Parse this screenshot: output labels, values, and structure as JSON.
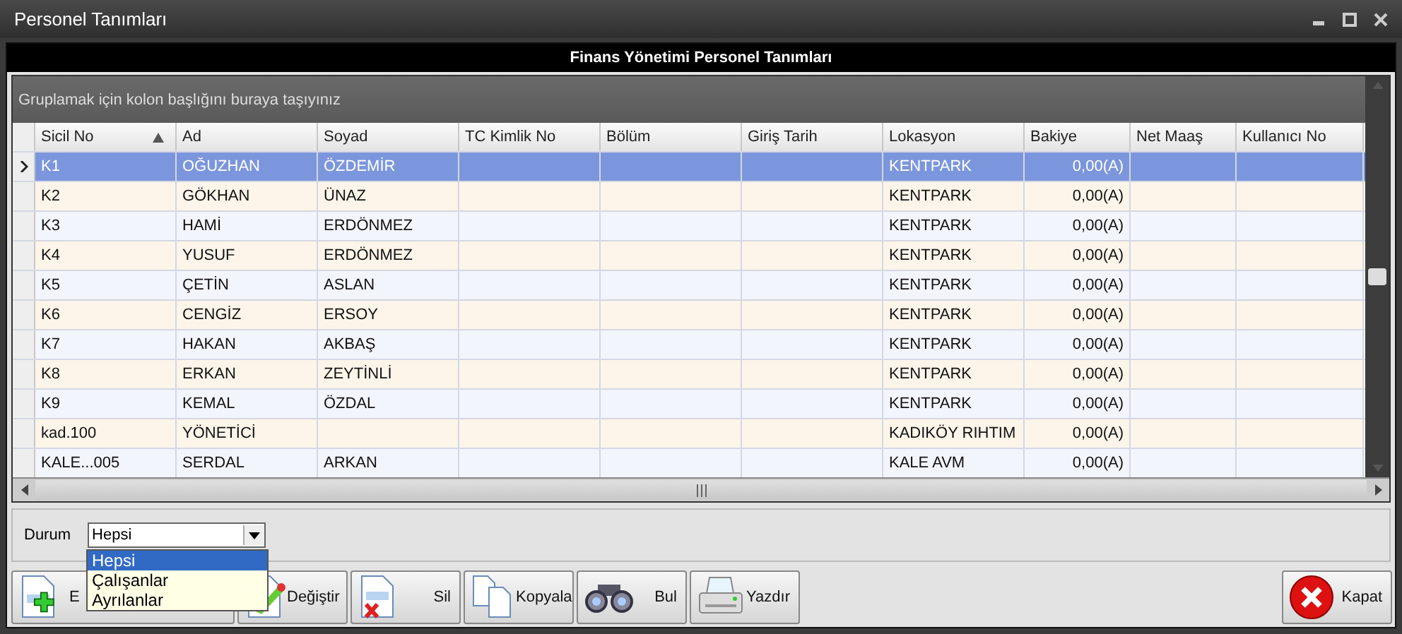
{
  "window": {
    "title": "Personel Tanımları"
  },
  "header": "Finans Yönetimi Personel Tanımları",
  "group_panel": "Gruplamak için kolon başlığını buraya taşıyınız",
  "table": {
    "columns": [
      {
        "label": "Sicil No",
        "sorted": true
      },
      {
        "label": "Ad",
        "sorted": false
      },
      {
        "label": "Soyad",
        "sorted": false
      },
      {
        "label": "TC Kimlik No",
        "sorted": false
      },
      {
        "label": "Bölüm",
        "sorted": false
      },
      {
        "label": "Giriş Tarih",
        "sorted": false
      },
      {
        "label": "Lokasyon",
        "sorted": false
      },
      {
        "label": "Bakiye",
        "sorted": false
      },
      {
        "label": "Net Maaş",
        "sorted": false
      },
      {
        "label": "Kullanıcı No",
        "sorted": false
      }
    ],
    "rows": [
      {
        "selected": true,
        "cells": [
          "K1",
          "OĞUZHAN",
          "ÖZDEMİR",
          "",
          "",
          "",
          "KENTPARK",
          "0,00(A)",
          "",
          ""
        ]
      },
      {
        "selected": false,
        "cells": [
          "K2",
          "GÖKHAN",
          "ÜNAZ",
          "",
          "",
          "",
          "KENTPARK",
          "0,00(A)",
          "",
          ""
        ]
      },
      {
        "selected": false,
        "cells": [
          "K3",
          "HAMİ",
          "ERDÖNMEZ",
          "",
          "",
          "",
          "KENTPARK",
          "0,00(A)",
          "",
          ""
        ]
      },
      {
        "selected": false,
        "cells": [
          "K4",
          "YUSUF",
          "ERDÖNMEZ",
          "",
          "",
          "",
          "KENTPARK",
          "0,00(A)",
          "",
          ""
        ]
      },
      {
        "selected": false,
        "cells": [
          "K5",
          "ÇETİN",
          "ASLAN",
          "",
          "",
          "",
          "KENTPARK",
          "0,00(A)",
          "",
          ""
        ]
      },
      {
        "selected": false,
        "cells": [
          "K6",
          "CENGİZ",
          "ERSOY",
          "",
          "",
          "",
          "KENTPARK",
          "0,00(A)",
          "",
          ""
        ]
      },
      {
        "selected": false,
        "cells": [
          "K7",
          "HAKAN",
          "AKBAŞ",
          "",
          "",
          "",
          "KENTPARK",
          "0,00(A)",
          "",
          ""
        ]
      },
      {
        "selected": false,
        "cells": [
          "K8",
          "ERKAN",
          "ZEYTİNLİ",
          "",
          "",
          "",
          "KENTPARK",
          "0,00(A)",
          "",
          ""
        ]
      },
      {
        "selected": false,
        "cells": [
          "K9",
          "KEMAL",
          "ÖZDAL",
          "",
          "",
          "",
          "KENTPARK",
          "0,00(A)",
          "",
          ""
        ]
      },
      {
        "selected": false,
        "cells": [
          "kad.100",
          "YÖNETİCİ",
          "",
          "",
          "",
          "",
          "KADIKÖY RIHTIM",
          "0,00(A)",
          "",
          ""
        ]
      },
      {
        "selected": false,
        "cells": [
          "KALE...005",
          "SERDAL",
          "ARKAN",
          "",
          "",
          "",
          "KALE AVM",
          "0,00(A)",
          "",
          ""
        ]
      }
    ]
  },
  "filter": {
    "label": "Durum",
    "value": "Hepsi",
    "options": [
      {
        "label": "Hepsi",
        "selected": true
      },
      {
        "label": "Çalışanlar",
        "selected": false
      },
      {
        "label": "Ayrılanlar",
        "selected": false
      }
    ]
  },
  "buttons": [
    {
      "kind": "add",
      "label": "E"
    },
    {
      "kind": "edit",
      "label": "Değiştir"
    },
    {
      "kind": "delete",
      "label": "Sil"
    },
    {
      "kind": "copy",
      "label": "Kopyala"
    },
    {
      "kind": "find",
      "label": "Bul"
    },
    {
      "kind": "print",
      "label": "Yazdır"
    },
    {
      "kind": "close",
      "label": "Kapat"
    }
  ]
}
